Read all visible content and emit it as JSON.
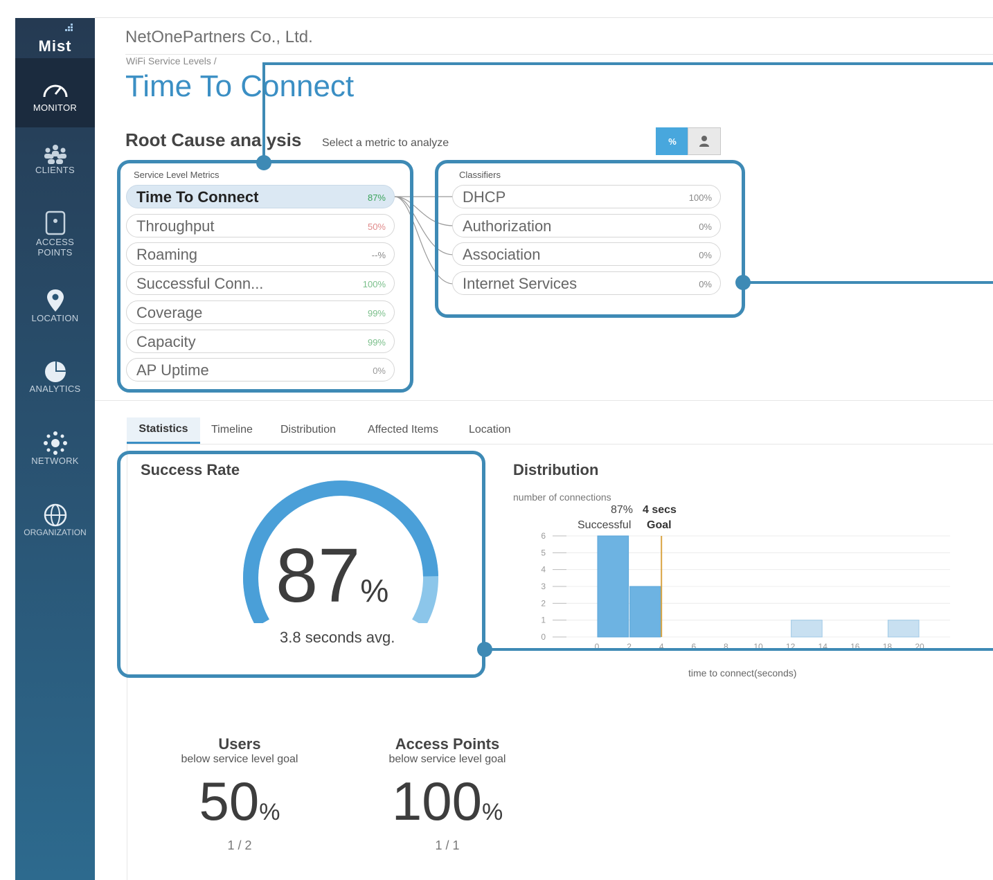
{
  "sidebar": {
    "logo": "Mist",
    "items": [
      {
        "label": "MONITOR",
        "icon": "speedometer-icon"
      },
      {
        "label": "CLIENTS",
        "icon": "clients-icon"
      },
      {
        "label1": "ACCESS",
        "label2": "POINTS",
        "icon": "access-point-icon"
      },
      {
        "label": "LOCATION",
        "icon": "map-pin-icon"
      },
      {
        "label": "ANALYTICS",
        "icon": "pie-chart-icon"
      },
      {
        "label": "NETWORK",
        "icon": "network-icon"
      },
      {
        "label": "ORGANIZATION",
        "icon": "globe-icon"
      }
    ]
  },
  "header": {
    "company": "NetOnePartners Co., Ltd.",
    "breadcrumb": "WiFi Service Levels /",
    "title": "Time To Connect"
  },
  "rca": {
    "title": "Root Cause analysis",
    "subtitle": "Select a metric to analyze",
    "toggle_percent": "%",
    "toggle_user_icon": "user-icon"
  },
  "metrics": {
    "label": "Service Level Metrics",
    "items": [
      {
        "name": "Time To Connect",
        "value": "87%",
        "color": "#3aa35a"
      },
      {
        "name": "Throughput",
        "value": "50%",
        "color": "#e08a8a"
      },
      {
        "name": "Roaming",
        "value": "--%",
        "color": "#888888"
      },
      {
        "name": "Successful Conn...",
        "value": "100%",
        "color": "#7bbf8b"
      },
      {
        "name": "Coverage",
        "value": "99%",
        "color": "#7bbf8b"
      },
      {
        "name": "Capacity",
        "value": "99%",
        "color": "#7bbf8b"
      },
      {
        "name": "AP Uptime",
        "value": "0%",
        "color": "#999999"
      }
    ]
  },
  "classifiers": {
    "label": "Classifiers",
    "items": [
      {
        "name": "DHCP",
        "value": "100%"
      },
      {
        "name": "Authorization",
        "value": "0%"
      },
      {
        "name": "Association",
        "value": "0%"
      },
      {
        "name": "Internet Services",
        "value": "0%"
      }
    ]
  },
  "tabs": [
    "Statistics",
    "Timeline",
    "Distribution",
    "Affected Items",
    "Location"
  ],
  "success_rate": {
    "title": "Success Rate",
    "value": "87",
    "unit": "%",
    "avg": "3.8 seconds avg.",
    "fraction": 0.87
  },
  "distribution": {
    "title": "Distribution",
    "ylabel": "number of connections",
    "successful_pct": "87%",
    "successful_label": "Successful",
    "goal_value": "4 secs",
    "goal_label": "Goal",
    "xlabel": "time to connect(seconds)"
  },
  "chart_data": {
    "type": "bar",
    "xlabel": "time to connect(seconds)",
    "ylabel": "number of connections",
    "x_ticks": [
      0,
      2,
      4,
      6,
      8,
      10,
      12,
      14,
      16,
      18,
      20
    ],
    "y_ticks": [
      0,
      1,
      2,
      3,
      4,
      5,
      6
    ],
    "xlim": [
      0,
      20
    ],
    "ylim": [
      0,
      6
    ],
    "bins": [
      {
        "start": 0,
        "end": 2,
        "value": 6,
        "successful": true
      },
      {
        "start": 2,
        "end": 4,
        "value": 3,
        "successful": true
      },
      {
        "start": 12,
        "end": 14,
        "value": 1,
        "successful": false
      },
      {
        "start": 18,
        "end": 20,
        "value": 1,
        "successful": false
      }
    ],
    "goal": 4,
    "colors": {
      "success": "#6db3e2",
      "fail": "#c8e0f1",
      "goal": "#d9a441"
    }
  },
  "users": {
    "title": "Users",
    "subtitle": "below service level goal",
    "value": "50",
    "unit": "%",
    "fraction": "1 / 2"
  },
  "access_points": {
    "title": "Access Points",
    "subtitle": "below service level goal",
    "value": "100",
    "unit": "%",
    "fraction": "1 / 1"
  }
}
